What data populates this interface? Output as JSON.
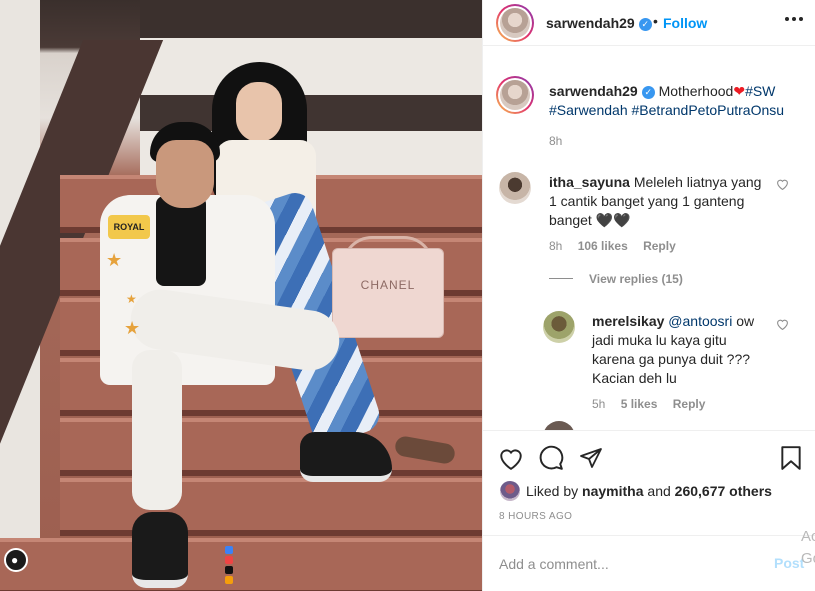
{
  "post": {
    "username": "sarwendah29",
    "follow_label": "Follow",
    "header_dot": "•",
    "more_icon": "more-horizontal-icon"
  },
  "caption": {
    "username": "sarwendah29",
    "text_1": "Motherhood",
    "heart": "❤",
    "tag_1": "#SW",
    "tag_2": "#Sarwendah",
    "tag_3": "#BetrandPetoPutraOnsu",
    "time": "8h"
  },
  "comments": [
    {
      "username": "itha_sayuna",
      "text": "Meleleh liatnya yang 1 cantik banget yang 1 ganteng banget 🖤🖤",
      "time": "8h",
      "likes": "106 likes",
      "reply_label": "Reply",
      "view_replies": "View replies (15)"
    },
    {
      "username": "merelsikay",
      "mention": "@antoosri",
      "text": "ow jadi muka lu kaya gitu karena ga punya duit ??? Kacian deh lu",
      "time": "5h",
      "likes": "5 likes",
      "reply_label": "Reply"
    }
  ],
  "actions": {
    "liked_by_prefix": "Liked by",
    "liked_by_user": "naymitha",
    "liked_by_and": "and",
    "liked_by_count": "260,677 others",
    "post_age": "8 HOURS AGO"
  },
  "add_comment": {
    "placeholder": "Add a comment...",
    "post_label": "Post"
  },
  "photo": {
    "bag_text": "CHANEL",
    "crown_text": "ROYAL"
  },
  "overlay": {
    "text_a": "Ac",
    "text_b": "Go"
  },
  "colors": {
    "follow_blue": "#0095f6",
    "post_disabled": "#b2dffc",
    "heart_red": "#ed1c24",
    "verified_blue": "#3897f0"
  }
}
